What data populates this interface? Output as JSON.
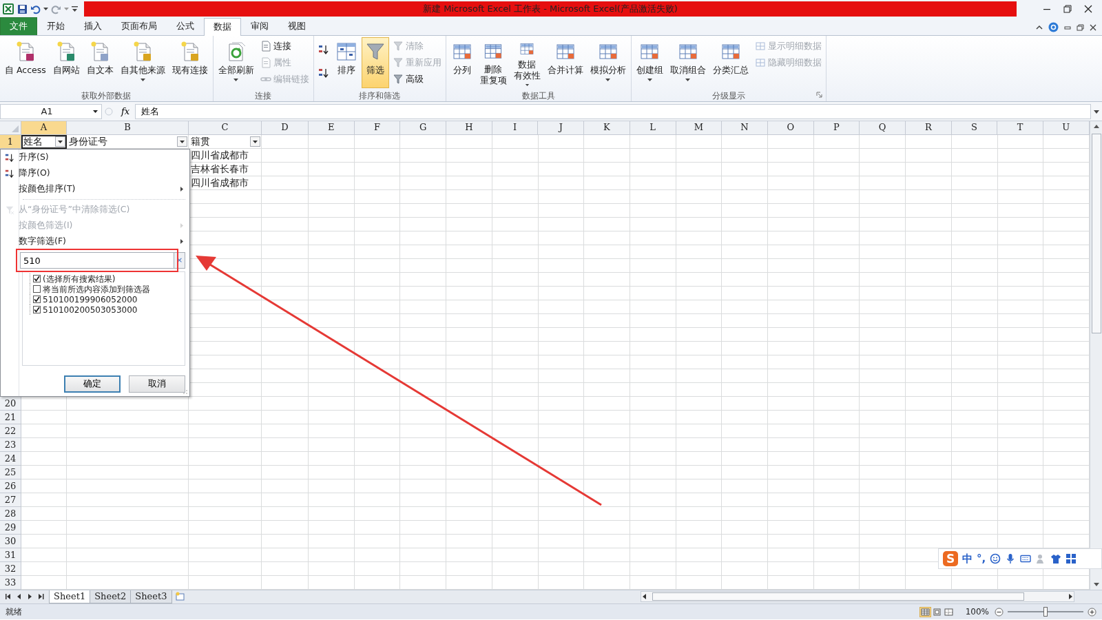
{
  "window": {
    "title": "新建 Microsoft Excel 工作表 - Microsoft Excel(产品激活失败)"
  },
  "ribbon_tabs": [
    {
      "label": "文件",
      "kind": "file",
      "selected": false
    },
    {
      "label": "开始",
      "kind": "tab",
      "selected": false
    },
    {
      "label": "插入",
      "kind": "tab",
      "selected": false
    },
    {
      "label": "页面布局",
      "kind": "tab",
      "selected": false
    },
    {
      "label": "公式",
      "kind": "tab",
      "selected": false
    },
    {
      "label": "数据",
      "kind": "tab",
      "selected": true
    },
    {
      "label": "审阅",
      "kind": "tab",
      "selected": false
    },
    {
      "label": "视图",
      "kind": "tab",
      "selected": false
    }
  ],
  "ribbon_groups": [
    {
      "label": "获取外部数据",
      "items": [
        {
          "label": "自 Access",
          "kind": "large",
          "disabled": false,
          "selected": false,
          "dropdown": false
        },
        {
          "label": "自网站",
          "kind": "large",
          "disabled": false,
          "selected": false,
          "dropdown": false
        },
        {
          "label": "自文本",
          "kind": "large",
          "disabled": false,
          "selected": false,
          "dropdown": false
        },
        {
          "label": "自其他来源",
          "kind": "large",
          "disabled": false,
          "selected": false,
          "dropdown": true
        },
        {
          "label": "现有连接",
          "kind": "large",
          "disabled": false,
          "selected": false,
          "dropdown": false
        }
      ]
    },
    {
      "label": "连接",
      "items": [
        {
          "label": "全部刷新",
          "kind": "large",
          "disabled": false,
          "selected": false,
          "dropdown": true
        },
        {
          "label": "连接",
          "kind": "small",
          "disabled": false,
          "selected": false,
          "dropdown": false
        },
        {
          "label": "属性",
          "kind": "small",
          "disabled": true,
          "selected": false,
          "dropdown": false
        },
        {
          "label": "编辑链接",
          "kind": "small",
          "disabled": true,
          "selected": false,
          "dropdown": false
        }
      ]
    },
    {
      "label": "排序和筛选",
      "items": [
        {
          "kind": "icon",
          "disabled": false,
          "selected": false,
          "dropdown": false
        },
        {
          "kind": "icon",
          "disabled": false,
          "selected": false,
          "dropdown": false
        },
        {
          "label": "排序",
          "kind": "large",
          "disabled": false,
          "selected": false,
          "dropdown": false
        },
        {
          "label": "筛选",
          "kind": "large",
          "disabled": false,
          "selected": true,
          "dropdown": false
        },
        {
          "label": "清除",
          "kind": "small",
          "disabled": true,
          "selected": false,
          "dropdown": false
        },
        {
          "label": "重新应用",
          "kind": "small",
          "disabled": true,
          "selected": false,
          "dropdown": false
        },
        {
          "label": "高级",
          "kind": "small",
          "disabled": false,
          "selected": false,
          "dropdown": false
        }
      ]
    },
    {
      "label": "数据工具",
      "items": [
        {
          "label": "分列",
          "kind": "large",
          "disabled": false,
          "selected": false,
          "dropdown": false
        },
        {
          "lines": [
            "删除",
            "重复项"
          ],
          "kind": "large",
          "disabled": false,
          "selected": false,
          "dropdown": false
        },
        {
          "lines": [
            "数据",
            "有效性"
          ],
          "kind": "large",
          "disabled": false,
          "selected": false,
          "dropdown": true
        },
        {
          "label": "合并计算",
          "kind": "large",
          "disabled": false,
          "selected": false,
          "dropdown": false
        },
        {
          "label": "模拟分析",
          "kind": "large",
          "disabled": false,
          "selected": false,
          "dropdown": true
        }
      ]
    },
    {
      "label": "分级显示",
      "launcher": true,
      "items": [
        {
          "label": "创建组",
          "kind": "large",
          "disabled": false,
          "selected": false,
          "dropdown": true
        },
        {
          "label": "取消组合",
          "kind": "large",
          "disabled": false,
          "selected": false,
          "dropdown": true
        },
        {
          "label": "分类汇总",
          "kind": "large",
          "disabled": false,
          "selected": false,
          "dropdown": false
        },
        {
          "label": "显示明细数据",
          "kind": "small",
          "disabled": true,
          "selected": false,
          "dropdown": false
        },
        {
          "label": "隐藏明细数据",
          "kind": "small",
          "disabled": true,
          "selected": false,
          "dropdown": false
        }
      ]
    }
  ],
  "formula_bar": {
    "name_box": "A1",
    "fx": "fx",
    "value": "姓名"
  },
  "sheet": {
    "columns": [
      {
        "label": "A",
        "selected": true
      },
      {
        "label": "B",
        "selected": false
      },
      {
        "label": "C",
        "selected": false
      },
      {
        "label": "D",
        "selected": false
      },
      {
        "label": "E",
        "selected": false
      },
      {
        "label": "F",
        "selected": false
      },
      {
        "label": "G",
        "selected": false
      },
      {
        "label": "H",
        "selected": false
      },
      {
        "label": "I",
        "selected": false
      },
      {
        "label": "J",
        "selected": false
      },
      {
        "label": "K",
        "selected": false
      },
      {
        "label": "L",
        "selected": false
      },
      {
        "label": "M",
        "selected": false
      },
      {
        "label": "N",
        "selected": false
      },
      {
        "label": "O",
        "selected": false
      },
      {
        "label": "P",
        "selected": false
      },
      {
        "label": "Q",
        "selected": false
      },
      {
        "label": "R",
        "selected": false
      },
      {
        "label": "S",
        "selected": false
      },
      {
        "label": "T",
        "selected": false
      },
      {
        "label": "U",
        "selected": false
      }
    ],
    "header_row": {
      "number": "1",
      "selected": true,
      "cells": [
        {
          "text": "姓名",
          "filter": true
        },
        {
          "text": "身份证号",
          "filter": true
        },
        {
          "text": "籍贯",
          "filter": true
        }
      ]
    },
    "data_rows": [
      {
        "column_c": "四川省成都市"
      },
      {
        "column_c": "吉林省长春市"
      },
      {
        "column_c": "四川省成都市"
      }
    ],
    "row_numbers": [
      "20",
      "21",
      "22",
      "23",
      "24",
      "25",
      "26",
      "27",
      "28",
      "29",
      "30",
      "31",
      "32",
      "33"
    ]
  },
  "filter_menu": {
    "items": [
      {
        "label": "升序(S)",
        "kind": "item",
        "disabled": false,
        "submenu": false
      },
      {
        "label": "降序(O)",
        "kind": "item",
        "disabled": false,
        "submenu": false
      },
      {
        "label": "按颜色排序(T)",
        "kind": "item",
        "disabled": false,
        "submenu": true
      },
      {
        "kind": "separator"
      },
      {
        "label": "从“身份证号”中清除筛选(C)",
        "kind": "item",
        "disabled": true,
        "submenu": false
      },
      {
        "label": "按颜色筛选(I)",
        "kind": "item",
        "disabled": true,
        "submenu": true
      },
      {
        "label": "数字筛选(F)",
        "kind": "item",
        "disabled": false,
        "submenu": true
      }
    ],
    "search": {
      "value": "510",
      "clear": "×"
    },
    "checklist": [
      {
        "label": "(选择所有搜索结果)",
        "checked": true
      },
      {
        "label": "将当前所选内容添加到筛选器",
        "checked": false
      },
      {
        "label": "510100199906052000",
        "checked": true
      },
      {
        "label": "510100200503053000",
        "checked": true
      }
    ],
    "buttons": [
      {
        "label": "确定",
        "default": true
      },
      {
        "label": "取消",
        "default": false
      }
    ]
  },
  "sheet_tabs": [
    {
      "label": "Sheet1",
      "selected": true
    },
    {
      "label": "Sheet2",
      "selected": false
    },
    {
      "label": "Sheet3",
      "selected": false
    }
  ],
  "status_bar": {
    "text": "就绪",
    "view_buttons": [
      {
        "selected": true
      },
      {
        "selected": false
      },
      {
        "selected": false
      }
    ],
    "zoom": "100%",
    "zoom_slider": {
      "level": 0.5
    }
  },
  "ime_toolbar": {
    "logo": "S",
    "mode": "中",
    "punctuation": "°,"
  }
}
